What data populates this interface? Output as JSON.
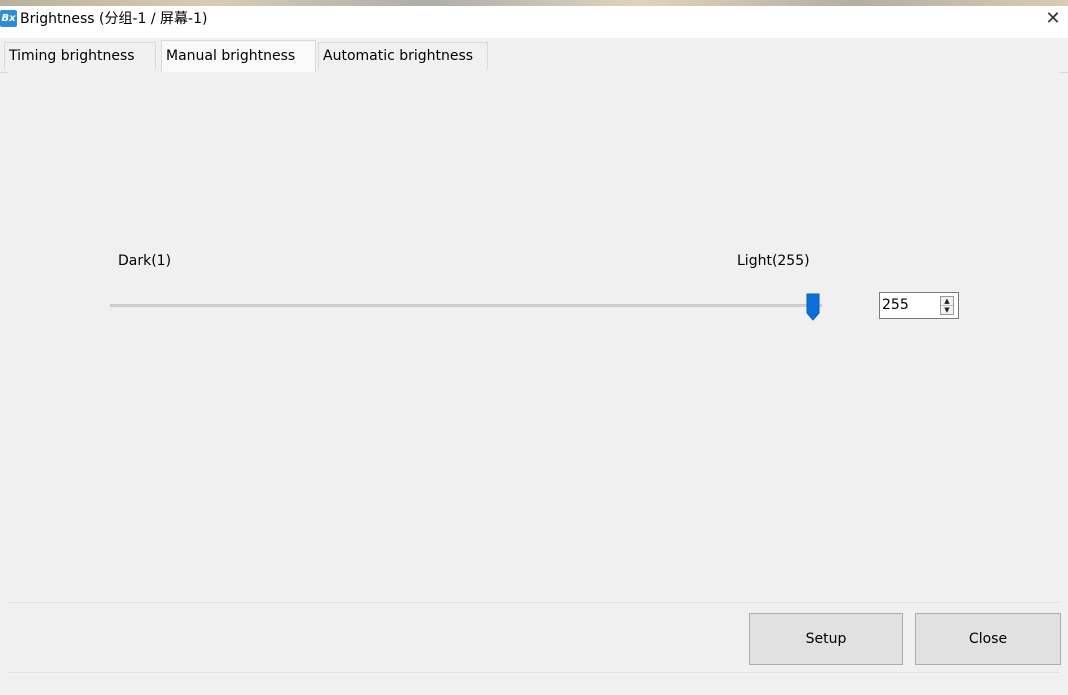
{
  "window": {
    "app_icon_text": "Bx",
    "title": "Brightness  (分组-1 / 屏幕-1)",
    "close_glyph": "✕"
  },
  "tabs": [
    {
      "label": "Timing brightness",
      "active": false
    },
    {
      "label": "Manual brightness",
      "active": true
    },
    {
      "label": "Automatic brightness",
      "active": false
    }
  ],
  "manual": {
    "min_label": "Dark(1)",
    "max_label": "Light(255)",
    "slider": {
      "min": 1,
      "max": 255,
      "value": 255
    },
    "spin_value": "255",
    "thumb_color": "#0a6fd6"
  },
  "buttons": {
    "setup": "Setup",
    "close": "Close"
  }
}
